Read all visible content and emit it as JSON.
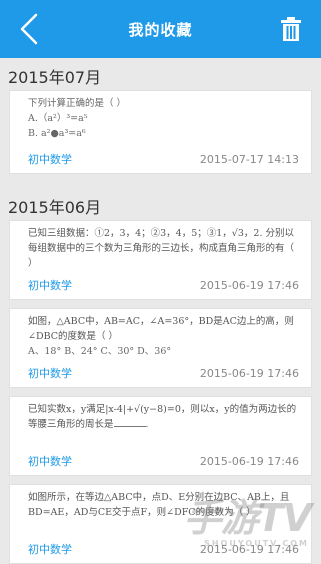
{
  "header": {
    "title": "我的收藏",
    "back_icon": "chevron-left-icon",
    "trash_icon": "trash-icon",
    "bar_color": "#1f9ae8"
  },
  "groups": [
    {
      "month": "2015年07月",
      "items": [
        {
          "question_line1": "下列计算正确的是（    ）",
          "option_a": "A.（a²）³=a⁵",
          "option_b": "B. a²●a³=a⁶",
          "subject": "初中数学",
          "date": "2015-07-17 14:13"
        }
      ]
    },
    {
      "month": "2015年06月",
      "items": [
        {
          "question": "已知三组数据：①2，3，4；②3，4，5；③1，√3，2. 分别以每组数据中的三个数为三角形的三边长，构成直角三角形的有（    ）",
          "subject": "初中数学",
          "date": "2015-06-19 17:46"
        },
        {
          "question": "如图，△ABC中，AB=AC，∠A=36°，BD是AC边上的高，则∠DBC的度数是（    ）",
          "options": "A、18°   B、24°   C、30°   D、36°",
          "subject": "初中数学",
          "date": "2015-06-19 17:46"
        },
        {
          "question": "已知实数x，y满足|x-4|+√(y−8)=0，则以x，y的值为两边长的等腰三角形的周长是",
          "subject": "初中数学",
          "date": "2015-06-19 17:46"
        },
        {
          "question": "如图所示，在等边△ABC中，点D、E分别在边BC、AB上，且BD=AE，AD与CE交于点F，则∠DFC的度数为（    ）",
          "subject": "初中数学",
          "date": "2015-06-19 17:46"
        }
      ]
    }
  ],
  "watermark": {
    "text": "手游TV",
    "sub": "SHOUYOUTV.COM"
  }
}
